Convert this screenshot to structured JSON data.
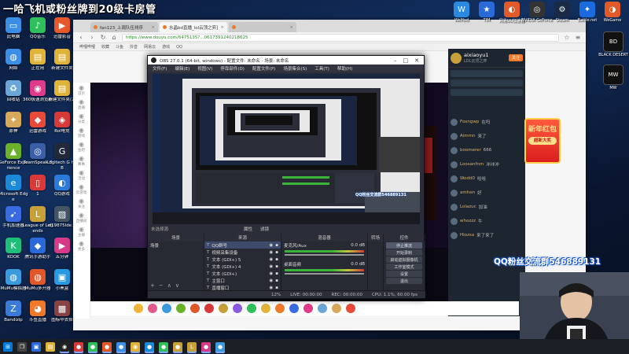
{
  "overlay": {
    "title": "一哈飞机或粉丝牌到20级卡房管",
    "qq_group": "QQ粉丝交流群546889131"
  },
  "desktop_icons_left": [
    {
      "label": "此电脑",
      "icon": "computer-icon",
      "color": "#3a8ee6",
      "glyph": "▭"
    },
    {
      "label": "QQ音乐",
      "icon": "qqmusic-icon",
      "color": "#2fbf5b",
      "glyph": "♪"
    },
    {
      "label": "迅雷影音",
      "icon": "xunlei-icon",
      "color": "#e8582a",
      "glyph": "▶"
    },
    {
      "label": "网络",
      "icon": "network-icon",
      "color": "#3a8ee6",
      "glyph": "◍"
    },
    {
      "label": "正在用",
      "icon": "folder-icon",
      "color": "#e0b43a",
      "glyph": "▤"
    },
    {
      "label": "新建文件夹",
      "icon": "folder-icon",
      "color": "#e0b43a",
      "glyph": "▤"
    },
    {
      "label": "回收站",
      "icon": "recycle-bin-icon",
      "color": "#6aa7d8",
      "glyph": "♻"
    },
    {
      "label": "360极速浏览器",
      "icon": "browser-360-icon",
      "color": "#e23a8a",
      "glyph": "◉"
    },
    {
      "label": "新建文件夹(2)",
      "icon": "folder-icon",
      "color": "#e0b43a",
      "glyph": "▤"
    },
    {
      "label": "原神",
      "icon": "genshin-icon",
      "color": "#d8a85a",
      "glyph": "✦"
    },
    {
      "label": "迅雷游戏",
      "icon": "xunlei-game-icon",
      "color": "#e84a3a",
      "glyph": "◆"
    },
    {
      "label": "Rol电竞",
      "icon": "rol-icon",
      "color": "#d83a3a",
      "glyph": "◈"
    },
    {
      "label": "GeForce Experience",
      "icon": "geforce-icon",
      "color": "#6ab22a",
      "glyph": "▲"
    },
    {
      "label": "TeamSpeak 3",
      "icon": "teamspeak-icon",
      "color": "#3a5ea8",
      "glyph": "◎"
    },
    {
      "label": "Logitech G HUB",
      "icon": "logitech-icon",
      "color": "#222a3a",
      "glyph": "G"
    },
    {
      "label": "Microsoft Edge",
      "icon": "edge-icon",
      "color": "#1a8ad8",
      "glyph": "e"
    },
    {
      "label": "1",
      "icon": "file-icon",
      "color": "#d83a3a",
      "glyph": "▯"
    },
    {
      "label": "QQ游戏",
      "icon": "qqgame-icon",
      "color": "#2a7ad8",
      "glyph": "◐"
    },
    {
      "label": "手机加速器",
      "icon": "accelerator-icon",
      "color": "#3a6ae0",
      "glyph": "➹"
    },
    {
      "label": "League of Legends",
      "icon": "lol-icon",
      "color": "#c8a03a",
      "glyph": "L"
    },
    {
      "label": "d19875lde...",
      "icon": "image-icon",
      "color": "#445566",
      "glyph": "▨"
    },
    {
      "label": "KOOK",
      "icon": "kook-icon",
      "color": "#1fbf7a",
      "glyph": "K"
    },
    {
      "label": "腾讯手游助手",
      "icon": "tencent-assist-icon",
      "color": "#2a6ad8",
      "glyph": "◆"
    },
    {
      "label": "五分钟",
      "icon": "app-icon",
      "color": "#d83a8a",
      "glyph": "▶"
    },
    {
      "label": "MuMu模拟器",
      "icon": "mumu-icon",
      "color": "#3a9ae0",
      "glyph": "◍"
    },
    {
      "label": "MuMu多开器",
      "icon": "mumu-multi-icon",
      "color": "#e0582a",
      "glyph": "◍"
    },
    {
      "label": "小黑盒",
      "icon": "heybox-icon",
      "color": "#2a9ae0",
      "glyph": "▣"
    },
    {
      "label": "Bandizip",
      "icon": "bandizip-icon",
      "color": "#3a7ad8",
      "glyph": "Z"
    },
    {
      "label": "斗鱼直播",
      "icon": "douyu-icon",
      "color": "#f07a2a",
      "glyph": "◕"
    },
    {
      "label": "图标中去掉",
      "icon": "app-icon",
      "color": "#884444",
      "glyph": "▩"
    }
  ],
  "desktop_icons_right": [
    {
      "label": "WeMod",
      "icon": "wemod-icon",
      "color": "#2a8ae0",
      "glyph": "W"
    },
    {
      "label": "TIM",
      "icon": "tim-icon",
      "color": "#2a6ad8",
      "glyph": "★"
    },
    {
      "label": "网易UU加速器",
      "icon": "uu-icon",
      "color": "#e05a2a",
      "glyph": "◐"
    },
    {
      "label": "NVIDIA GeForce",
      "icon": "nvidia-icon",
      "color": "#333",
      "glyph": "◎"
    },
    {
      "label": "Steam",
      "icon": "steam-icon",
      "color": "#1a2a44",
      "glyph": "⚙"
    },
    {
      "label": "Battle.net",
      "icon": "battlenet-icon",
      "color": "#1a6ae0",
      "glyph": "✦"
    },
    {
      "label": "WeGame",
      "icon": "wegame-icon",
      "color": "#e05a2a",
      "glyph": "◑"
    }
  ],
  "right_side_icons": [
    {
      "label": "BLACK DESERT",
      "icon": "blackdesert-icon",
      "color": "#111",
      "glyph": "BD"
    },
    {
      "label": "MW",
      "icon": "mw-icon",
      "color": "#111",
      "glyph": "MW"
    }
  ],
  "browser": {
    "tabs": [
      {
        "label": "fan123_上周队伍排序",
        "active": false
      },
      {
        "label": "水晶bd直播_lol云顶之弈直播",
        "active": true
      },
      {
        "label": "",
        "active": false
      }
    ],
    "url": "https://www.douyu.com/6475135?...0617391240218625",
    "bookmarks": [
      "哔哩哔哩",
      "收藏",
      "斗鱼",
      "抖音",
      "网易云",
      "游戏",
      "QQ"
    ]
  },
  "douyu": {
    "left_nav": [
      "首页",
      "直播",
      "分类",
      "游戏",
      "鱼吧",
      "赛事",
      "活动",
      "云游戏",
      "关注",
      "直播间",
      "主播",
      "更多"
    ],
    "streamer_name": "aixiaoyu1",
    "streamer_sub": "LOL云顶之弈",
    "follow_label": "关注",
    "chat": [
      {
        "user": "Foxngwp",
        "msg": "在吗"
      },
      {
        "user": "Aimmn",
        "msg": "来了"
      },
      {
        "user": "boomerer",
        "msg": "666"
      },
      {
        "user": "Loosanfnm",
        "msg": "冲冲冲"
      },
      {
        "user": "Wodd0",
        "msg": "哈哈"
      },
      {
        "user": "amhen",
        "msg": "好"
      },
      {
        "user": "Lolazuc",
        "msg": "加油"
      },
      {
        "user": "whozzz",
        "msg": "牛"
      },
      {
        "user": "Hiozsa",
        "msg": "来了来了"
      }
    ]
  },
  "newyear": {
    "title": "新年红包",
    "button": "超新大奖"
  },
  "obs": {
    "title": "OBS 27.0.1 (64-bit, windows) - 配置文件: 未命名 - 场景: 未命名",
    "menu": [
      "文件(F)",
      "编辑(E)",
      "视图(V)",
      "停靠部件(D)",
      "配置文件(P)",
      "场景集合(S)",
      "工具(T)",
      "帮助(H)"
    ],
    "no_source": "未选择源",
    "props_label": "属性",
    "filter_label": "滤镜",
    "dock_headers": [
      "场景",
      "来源",
      "混音器",
      "转场",
      "控件"
    ],
    "scenes": [
      "场景"
    ],
    "sources": [
      "QQ群号",
      "视频采集设备",
      "文本 (GDI+) 5",
      "文本 (GDI+) 4",
      "文本 (GDI+)",
      "主窗口",
      "直播窗口"
    ],
    "mixer": [
      {
        "name": "麦克风/Aux",
        "db": "0.0 dB"
      },
      {
        "name": "桌面音频",
        "db": "0.0 dB"
      }
    ],
    "controls": [
      "停止推流",
      "开始录制",
      "启动虚拟摄像机",
      "工作室模式",
      "设置",
      "退出"
    ],
    "status": {
      "live": "LIVE: 00:00:00",
      "rec": "REC: 00:00:00",
      "cpu": "CPU: 1.1%, 60.00 fps",
      "kbps": "12%"
    }
  },
  "colors": {
    "accent": "#f07a2a",
    "obs_bg": "#2b2e38",
    "green_meter": "#3bb33b"
  },
  "taskbar": {
    "items": [
      {
        "icon": "windows-start-icon",
        "color": "#0078d7",
        "glyph": "⊞"
      },
      {
        "icon": "taskview-icon",
        "color": "#444",
        "glyph": "❐"
      },
      {
        "icon": "store-icon",
        "color": "#2a6ad8",
        "glyph": "▣"
      },
      {
        "icon": "explorer-icon",
        "color": "#e0b43a",
        "glyph": "▤"
      },
      {
        "icon": "obs-icon",
        "color": "#222",
        "glyph": "◉"
      },
      {
        "icon": "app-icon",
        "color": "#d83a3a",
        "glyph": "●"
      },
      {
        "icon": "app-icon",
        "color": "#2fbf5b",
        "glyph": "●"
      },
      {
        "icon": "app-icon",
        "color": "#e0582a",
        "glyph": "●"
      },
      {
        "icon": "app-icon",
        "color": "#3a8ee6",
        "glyph": "●"
      },
      {
        "icon": "chrome-icon",
        "color": "#e0b43a",
        "glyph": "◉"
      },
      {
        "icon": "app-icon",
        "color": "#1a8ad8",
        "glyph": "●"
      },
      {
        "icon": "wechat-icon",
        "color": "#2fbf5b",
        "glyph": "●"
      },
      {
        "icon": "app-icon",
        "color": "#c8a03a",
        "glyph": "●"
      },
      {
        "icon": "lol-icon",
        "color": "#c8a03a",
        "glyph": "L"
      },
      {
        "icon": "app-icon",
        "color": "#d83a8a",
        "glyph": "●"
      },
      {
        "icon": "app-icon",
        "color": "#3a9ae0",
        "glyph": "●"
      }
    ]
  }
}
